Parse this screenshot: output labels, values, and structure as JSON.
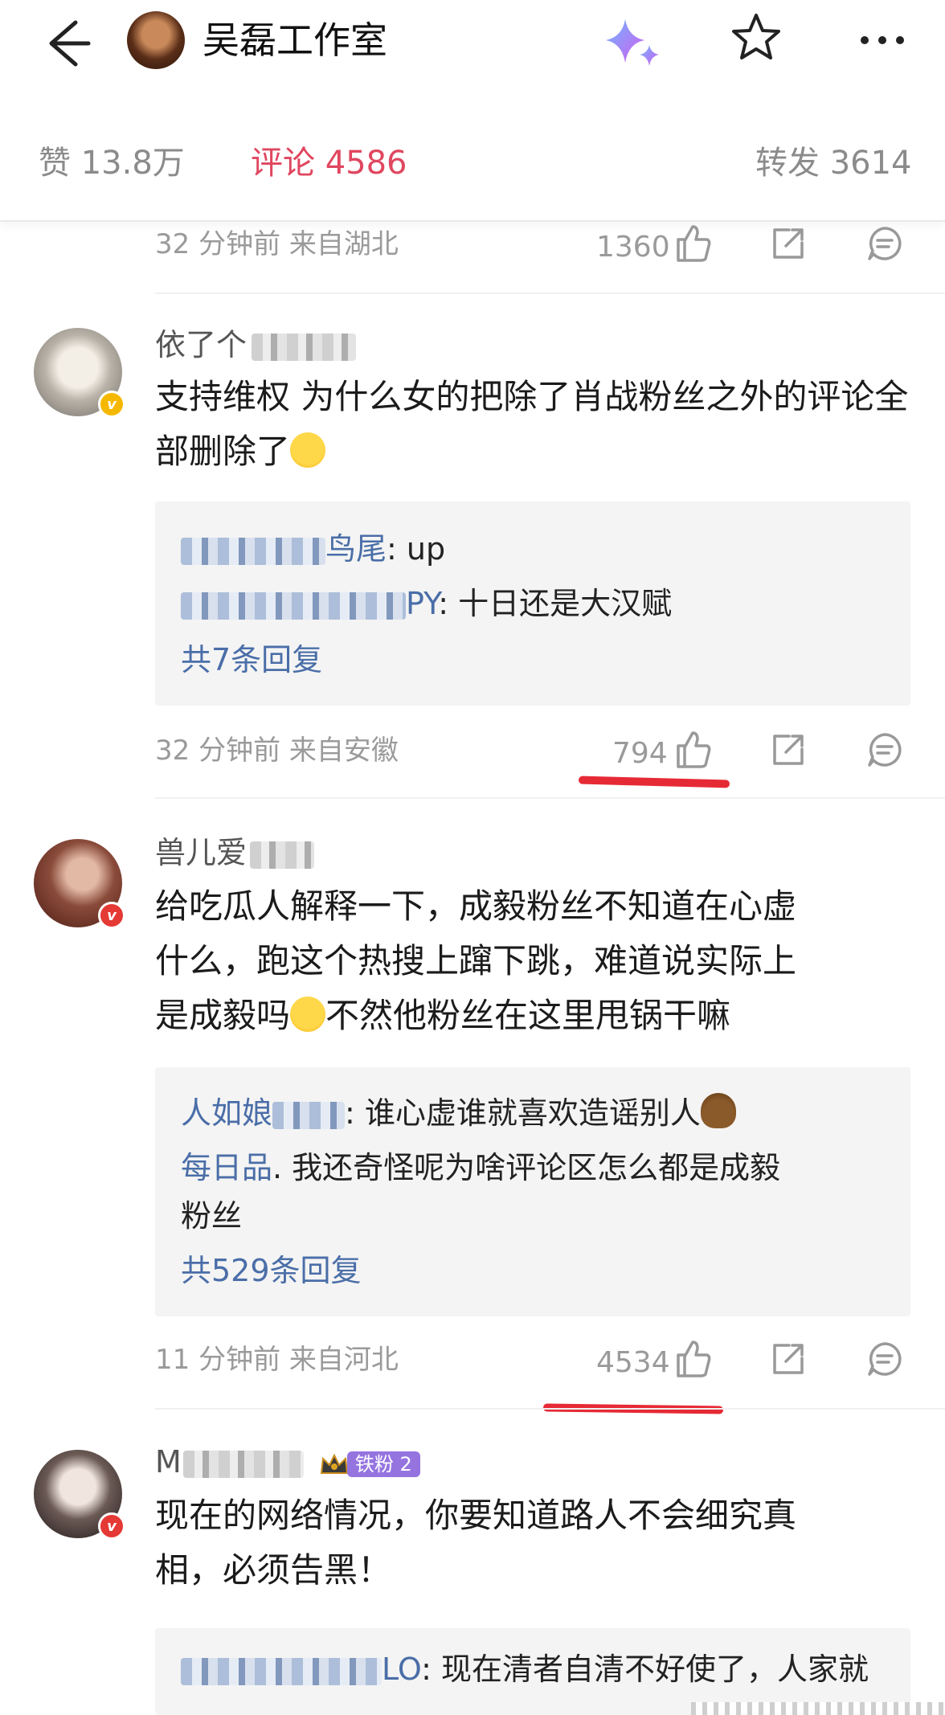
{
  "header": {
    "title": "吴磊工作室",
    "icons": {
      "back": "arrow-left-icon",
      "ai": "sparkle-icon",
      "favorite": "star-icon",
      "more": "more-dots-icon"
    }
  },
  "stats_tabs": {
    "likes": "赞 13.8万",
    "comments": "评论 4586",
    "reposts": "转发 3614",
    "active_color": "#e0475f"
  },
  "top_meta": {
    "time": "32 分钟前  来自湖北",
    "likes": "1360"
  },
  "comments": [
    {
      "username": "依了个",
      "text": "支持维权 为什么女的把除了肖战粉丝之外的评论全部删除了",
      "replies": [
        {
          "name": "鸟尾",
          "text": ": up"
        },
        {
          "name": "PY",
          "text": ": 十日还是大汉赋"
        }
      ],
      "more_replies": "共7条回复",
      "time": "32 分钟前  来自安徽",
      "likes": "794"
    },
    {
      "username": "兽儿爱",
      "text_lines": [
        "给吃瓜人解释一下，成毅粉丝不知道在心虚",
        "什么，跑这个热搜上蹿下跳，难道说实际上",
        "是成毅吗",
        "不然他粉丝在这里甩锅干嘛"
      ],
      "replies": [
        {
          "name": "人如娘",
          "text": ": 谁心虚谁就喜欢造谣别人"
        },
        {
          "name": "每日品",
          "text": ". 我还奇怪呢为啥评论区怎么都是成毅"
        },
        {
          "name": "",
          "text": "粉丝"
        }
      ],
      "more_replies": "共529条回复",
      "time": "11 分钟前  来自河北",
      "likes": "4534"
    },
    {
      "username": "M",
      "fan_badge": "铁粉 2",
      "text_lines": [
        "现在的网络情况，你要知道路人不会细究真",
        "相，必须告黑！"
      ],
      "replies": [
        {
          "name": "LO",
          "text": ": 现在清者自清不好使了，人家就"
        }
      ]
    }
  ]
}
